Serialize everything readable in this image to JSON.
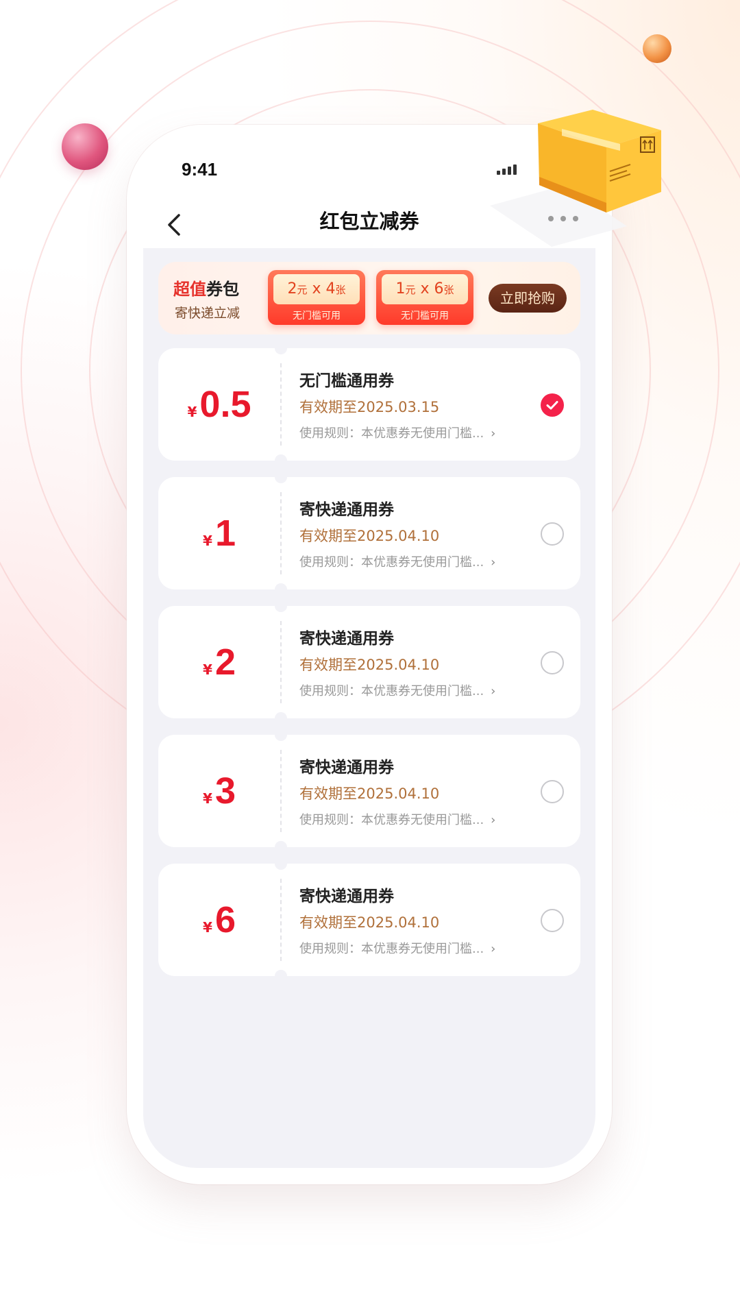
{
  "status": {
    "time": "9:41"
  },
  "nav": {
    "title": "红包立减券"
  },
  "promo": {
    "title_highlight": "超值",
    "title_rest": "券包",
    "subtitle": "寄快递立减",
    "coupons": [
      {
        "amount": "2",
        "unit": "元",
        "times": " x ",
        "count": "4",
        "count_unit": "张",
        "tag": "无门槛可用"
      },
      {
        "amount": "1",
        "unit": "元",
        "times": " x ",
        "count": "6",
        "count_unit": "张",
        "tag": "无门槛可用"
      }
    ],
    "button": "立即抢购"
  },
  "coupons": [
    {
      "currency": "¥",
      "amount": "0.5",
      "name": "无门槛通用券",
      "expiry": "有效期至2025.03.15",
      "rule": "使用规则：本优惠券无使用门槛...",
      "selected": true
    },
    {
      "currency": "¥",
      "amount": "1",
      "name": "寄快递通用券",
      "expiry": "有效期至2025.04.10",
      "rule": "使用规则：本优惠券无使用门槛...",
      "selected": false
    },
    {
      "currency": "¥",
      "amount": "2",
      "name": "寄快递通用券",
      "expiry": "有效期至2025.04.10",
      "rule": "使用规则：本优惠券无使用门槛...",
      "selected": false
    },
    {
      "currency": "¥",
      "amount": "3",
      "name": "寄快递通用券",
      "expiry": "有效期至2025.04.10",
      "rule": "使用规则：本优惠券无使用门槛...",
      "selected": false
    },
    {
      "currency": "¥",
      "amount": "6",
      "name": "寄快递通用券",
      "expiry": "有效期至2025.04.10",
      "rule": "使用规则：本优惠券无使用门槛...",
      "selected": false
    }
  ],
  "colors": {
    "accent": "#e8192c",
    "selected": "#f4224a",
    "expiry": "#b0703a"
  },
  "icons": {
    "back": "chevron-left-icon",
    "check": "check-icon",
    "rule_more": "chevron-right-icon"
  }
}
